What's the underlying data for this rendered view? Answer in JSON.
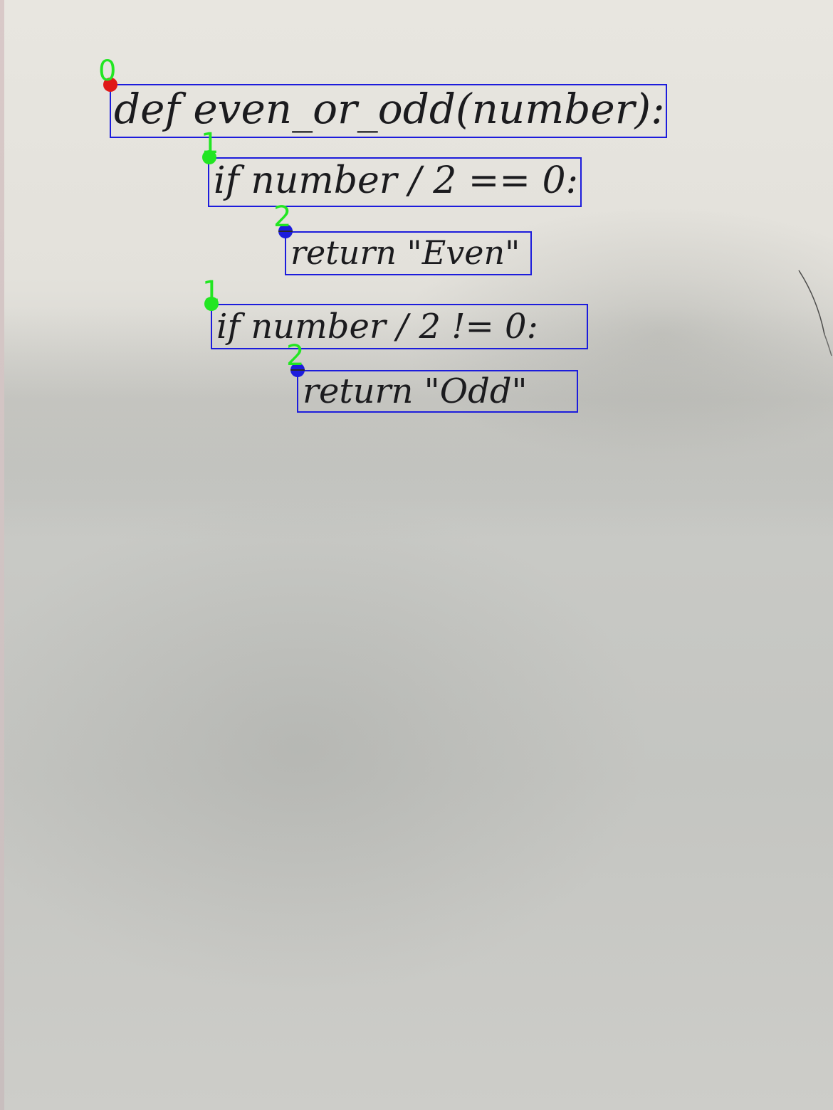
{
  "annotation_colors": {
    "box": "#1c1cdc",
    "level_label": "#22e622",
    "level_0_marker": "#e01818",
    "level_1_marker": "#22e622",
    "level_2_marker": "#1c1cdc"
  },
  "code_lines": [
    {
      "text": "def even_or_odd(number):",
      "indent_level": "0"
    },
    {
      "text": "if number / 2 == 0:",
      "indent_level": "1"
    },
    {
      "text": "return \"Even\"",
      "indent_level": "2"
    },
    {
      "text": "if number / 2 != 0:",
      "indent_level": "1"
    },
    {
      "text": "return \"Odd\"",
      "indent_level": "2"
    }
  ]
}
